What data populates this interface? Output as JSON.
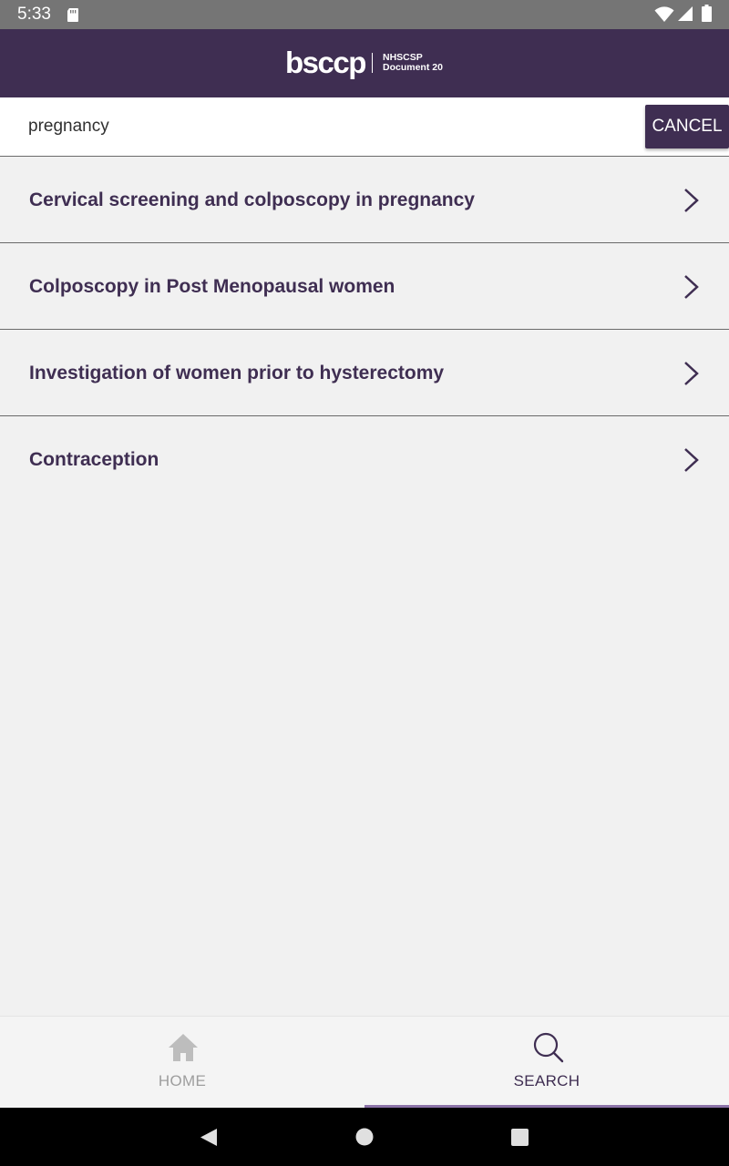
{
  "status_bar": {
    "time": "5:33",
    "icons": [
      "sd-card-icon",
      "wifi-icon",
      "signal-icon",
      "battery-icon"
    ]
  },
  "header": {
    "logo_text": "bsccp",
    "logo_subtitle_line1": "NHSCSP",
    "logo_subtitle_line2": "Document 20",
    "background_color": "#3f2e52"
  },
  "search": {
    "query": "pregnancy",
    "cancel_label": "CANCEL"
  },
  "results": [
    {
      "label": "Cervical screening and colposcopy in pregnancy"
    },
    {
      "label": "Colposcopy in Post Menopausal women"
    },
    {
      "label": "Investigation of women prior to hysterectomy"
    },
    {
      "label": "Contraception"
    }
  ],
  "bottom_nav": {
    "tabs": [
      {
        "label": "HOME",
        "icon": "home-icon",
        "active": false
      },
      {
        "label": "SEARCH",
        "icon": "search-icon",
        "active": true
      }
    ],
    "active_color": "#3f2e52",
    "indicator_color": "#8c73a8",
    "inactive_color": "#9e9e9e"
  },
  "system_nav": {
    "buttons": [
      "back-icon",
      "home-icon",
      "recents-icon"
    ]
  }
}
